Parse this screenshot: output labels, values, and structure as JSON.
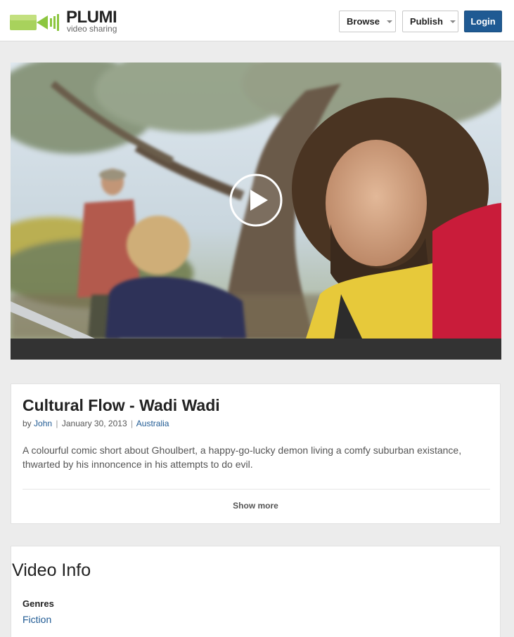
{
  "header": {
    "logo_word": "PLUMI",
    "logo_tagline": "video sharing",
    "browse_label": "Browse",
    "publish_label": "Publish",
    "login_label": "Login"
  },
  "video": {
    "play_icon": "play-icon"
  },
  "details": {
    "title": "Cultural Flow - Wadi Wadi",
    "by_prefix": "by",
    "author": "John",
    "date": "January 30, 2013",
    "country": "Australia",
    "separator": "|",
    "description": "A colourful comic short about Ghoulbert, a happy-go-lucky demon living a comfy suburban existance, thwarted by his innoncence in his attempts to do evil.",
    "show_more_label": "Show more"
  },
  "video_info": {
    "heading": "Video Info",
    "genres_label": "Genres",
    "genre": "Fiction"
  },
  "colors": {
    "accent": "#1f5a93",
    "logo_green": "#8cc63f",
    "page_bg": "#ececec",
    "player_bar": "#333333"
  }
}
